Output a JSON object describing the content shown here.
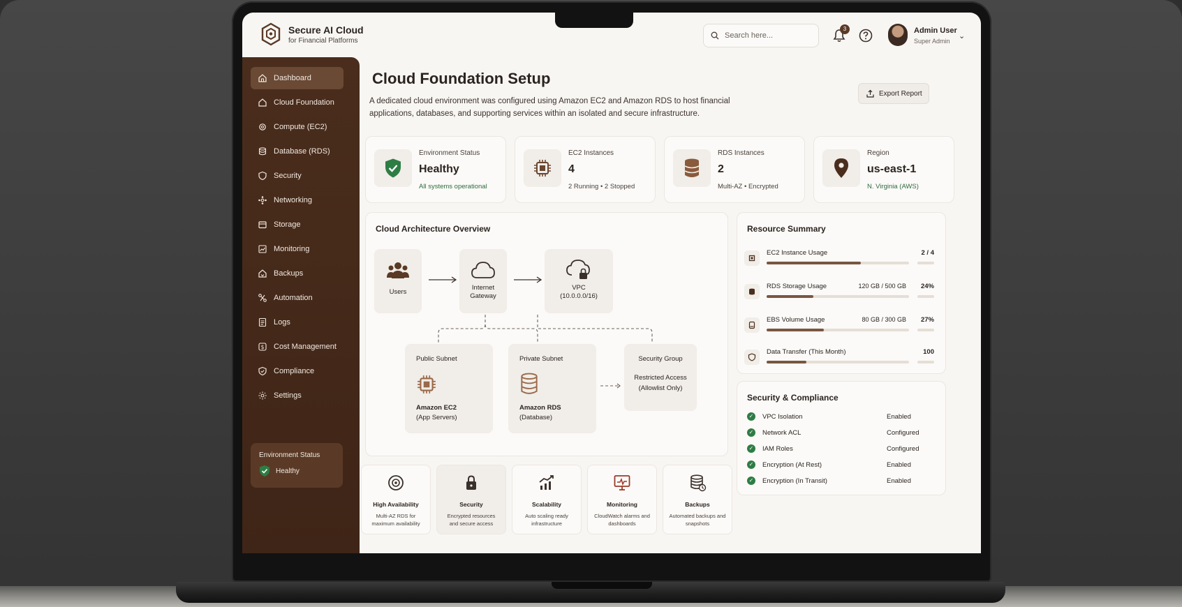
{
  "brand": {
    "title": "Secure AI Cloud",
    "subtitle": "for Financial Platforms"
  },
  "header": {
    "search_placeholder": "Search here...",
    "notification_count": "3",
    "user_name": "Admin User",
    "user_role": "Super Admin"
  },
  "sidebar": {
    "items": [
      {
        "label": "Dashboard",
        "icon": "home-icon"
      },
      {
        "label": "Cloud Foundation",
        "icon": "cloud-foundation-icon"
      },
      {
        "label": "Compute (EC2)",
        "icon": "gear-icon"
      },
      {
        "label": "Database (RDS)",
        "icon": "database-icon"
      },
      {
        "label": "Security",
        "icon": "shield-icon"
      },
      {
        "label": "Networking",
        "icon": "network-icon"
      },
      {
        "label": "Storage",
        "icon": "storage-icon"
      },
      {
        "label": "Monitoring",
        "icon": "chart-icon"
      },
      {
        "label": "Backups",
        "icon": "backup-icon"
      },
      {
        "label": "Automation",
        "icon": "automation-icon"
      },
      {
        "label": "Logs",
        "icon": "logs-icon"
      },
      {
        "label": "Cost Management",
        "icon": "dollar-icon"
      },
      {
        "label": "Compliance",
        "icon": "compliance-icon"
      },
      {
        "label": "Settings",
        "icon": "settings-icon"
      }
    ],
    "env_status_title": "Environment Status",
    "env_status_value": "Healthy"
  },
  "page": {
    "title": "Cloud Foundation Setup",
    "description": "A dedicated cloud environment was configured using Amazon EC2 and Amazon RDS to host financial applications, databases, and supporting services within an isolated and secure infrastructure.",
    "export_label": "Export Report"
  },
  "stats": [
    {
      "label": "Environment Status",
      "value": "Healthy",
      "sub": "All systems operational"
    },
    {
      "label": "EC2 Instances",
      "value": "4",
      "sub": "2 Running • 2 Stopped"
    },
    {
      "label": "RDS Instances",
      "value": "2",
      "sub": "Multi-AZ • Encrypted"
    },
    {
      "label": "Region",
      "value": "us-east-1",
      "sub": "N. Virginia (AWS)"
    }
  ],
  "architecture": {
    "title": "Cloud Architecture Overview",
    "users": "Users",
    "gateway_line1": "Internet",
    "gateway_line2": "Gateway",
    "vpc_line1": "VPC",
    "vpc_line2": "(10.0.0.0/16)",
    "public_subnet": "Public Subnet",
    "ec2_name": "Amazon EC2",
    "ec2_desc": "(App Servers)",
    "private_subnet": "Private Subnet",
    "rds_name": "Amazon RDS",
    "rds_desc": "(Database)",
    "sg_title": "Security Group",
    "sg_line1": "Restricted Access",
    "sg_line2": "(Allowlist Only)"
  },
  "resources": {
    "title": "Resource Summary",
    "items": [
      {
        "label": "EC2 Instance Usage",
        "amount": "",
        "value": "2 / 4",
        "fill": 0.66
      },
      {
        "label": "RDS Storage Usage",
        "amount": "120 GB / 500 GB",
        "value": "24%",
        "fill": 0.33
      },
      {
        "label": "EBS Volume Usage",
        "amount": "80 GB / 300 GB",
        "value": "27%",
        "fill": 0.4
      },
      {
        "label": "Data Transfer (This Month)",
        "amount": "",
        "value": "100",
        "fill": 0.28
      }
    ]
  },
  "security": {
    "title": "Security & Compliance",
    "items": [
      {
        "label": "VPC Isolation",
        "status": "Enabled"
      },
      {
        "label": "Network ACL",
        "status": "Configured"
      },
      {
        "label": "IAM Roles",
        "status": "Configured"
      },
      {
        "label": "Encryption (At Rest)",
        "status": "Enabled"
      },
      {
        "label": "Encryption (In Transit)",
        "status": "Enabled"
      }
    ]
  },
  "features": [
    {
      "title": "High Availability",
      "desc": "Multi-AZ RDS for maximum availability"
    },
    {
      "title": "Security",
      "desc": "Encrypted resources and secure access"
    },
    {
      "title": "Scalability",
      "desc": "Auto scaling ready infrastructure"
    },
    {
      "title": "Monitoring",
      "desc": "CloudWatch alarms and dashboards"
    },
    {
      "title": "Backups",
      "desc": "Automated backups and snapshots"
    }
  ],
  "colors": {
    "sidebar": "#4a2d1c",
    "accent": "#7a5640",
    "success": "#2e7d45",
    "background": "#f8f6f3"
  }
}
